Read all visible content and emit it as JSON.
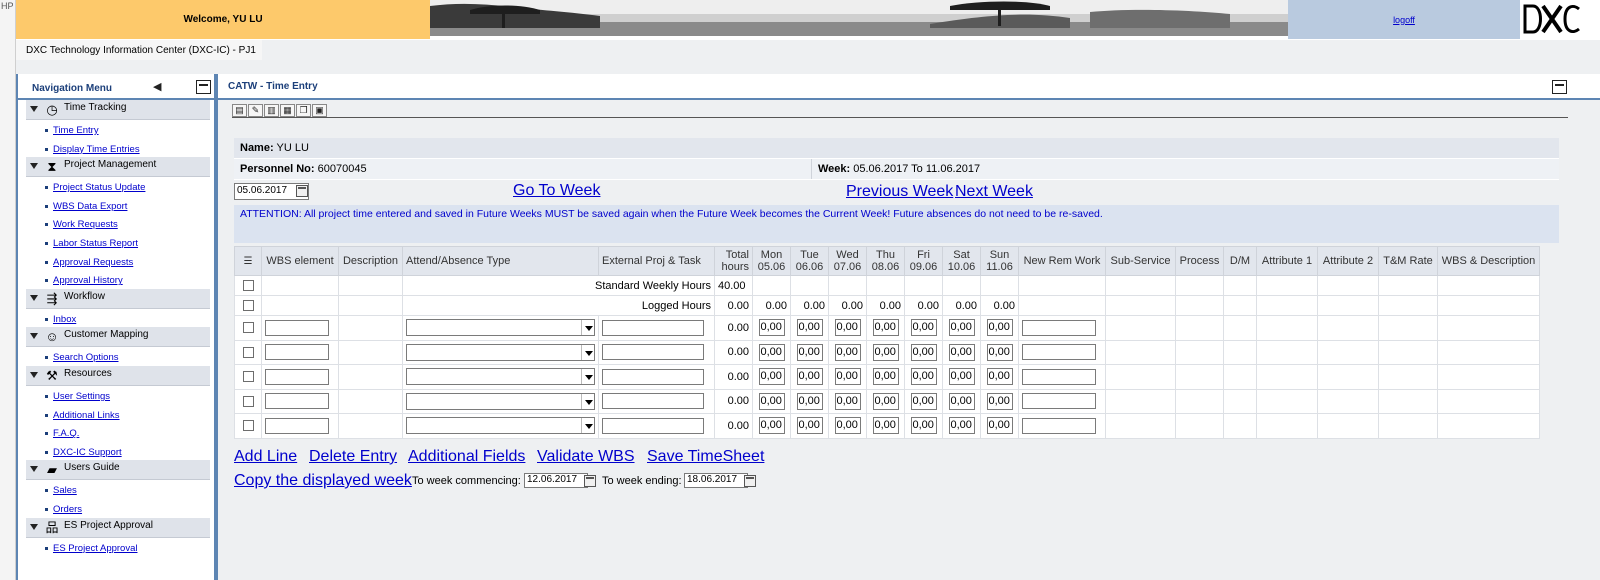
{
  "header": {
    "corner_tag": "HP",
    "welcome": "Welcome, YU LU",
    "logoff": "logoff",
    "logo_text": "DXC",
    "subheader": "DXC Technology Information Center (DXC-IC) - PJ1"
  },
  "nav": {
    "title": "Navigation Menu",
    "sections": [
      {
        "label": "Time Tracking",
        "icon": "clock-icon",
        "items": [
          "Time Entry",
          "Display Time Entries"
        ]
      },
      {
        "label": "Project Management",
        "icon": "hourglass-icon",
        "items": [
          "Project Status Update",
          "WBS Data Export",
          "Work Requests",
          "Labor Status Report",
          "Approval Requests",
          "Approval History"
        ]
      },
      {
        "label": "Workflow",
        "icon": "workflow-icon",
        "items": [
          "Inbox"
        ]
      },
      {
        "label": "Customer Mapping",
        "icon": "people-icon",
        "items": [
          "Search Options"
        ]
      },
      {
        "label": "Resources",
        "icon": "tools-icon",
        "items": [
          "User Settings",
          "Additional Links",
          "F.A.Q.",
          "DXC-IC Support"
        ]
      },
      {
        "label": "Users Guide",
        "icon": "book-icon",
        "items": [
          "Sales",
          "Orders"
        ]
      },
      {
        "label": "ES Project Approval",
        "icon": "org-chart-icon",
        "items": [
          "ES Project Approval"
        ]
      }
    ]
  },
  "main": {
    "title": "CATW - Time Entry",
    "name_label": "Name:",
    "name_value": "YU LU",
    "personnel_label": "Personnel No:",
    "personnel_value": "60070045",
    "week_label": "Week:",
    "week_value": "05.06.2017 To 11.06.2017",
    "date_value": "05.06.2017",
    "go_to_week": "Go To Week",
    "previous_week": "Previous Week",
    "next_week": "Next Week",
    "attention": "ATTENTION: All project time entered and saved in Future Weeks MUST be saved again when the Future Week becomes the Current Week! Future absences do not need to be re-saved."
  },
  "grid": {
    "headers": {
      "wbs": "WBS element",
      "description": "Description",
      "attend": "Attend/Absence Type",
      "external": "External Proj & Task",
      "total_1": "Total",
      "total_2": "hours",
      "days": [
        {
          "d": "Mon",
          "dt": "05.06"
        },
        {
          "d": "Tue",
          "dt": "06.06"
        },
        {
          "d": "Wed",
          "dt": "07.06"
        },
        {
          "d": "Thu",
          "dt": "08.06"
        },
        {
          "d": "Fri",
          "dt": "09.06"
        },
        {
          "d": "Sat",
          "dt": "10.06"
        },
        {
          "d": "Sun",
          "dt": "11.06"
        }
      ],
      "new_rem_work": "New Rem Work",
      "sub_service": "Sub-Service",
      "process": "Process",
      "dm": "D/M",
      "attr1": "Attribute 1",
      "attr2": "Attribute 2",
      "tm_rate": "T&M Rate",
      "wbs_desc": "WBS & Description"
    },
    "standard_label": "Standard Weekly Hours",
    "standard_value": "40.00",
    "logged_label": "Logged Hours",
    "logged_total": "0.00",
    "logged_days": [
      "0.00",
      "0.00",
      "0.00",
      "0.00",
      "0.00",
      "0.00",
      "0.00"
    ],
    "row_total": "0.00",
    "day_value": "0,00"
  },
  "actions": {
    "add_line": "Add Line",
    "delete_entry": "Delete Entry",
    "additional_fields": "Additional Fields",
    "validate_wbs": "Validate WBS",
    "save_timesheet": "Save TimeSheet",
    "copy_week": "Copy the displayed week",
    "to_week_commencing": "To week commencing:",
    "commencing_date": "12.06.2017",
    "to_week_ending": "To week ending:",
    "ending_date": "18.06.2017"
  }
}
